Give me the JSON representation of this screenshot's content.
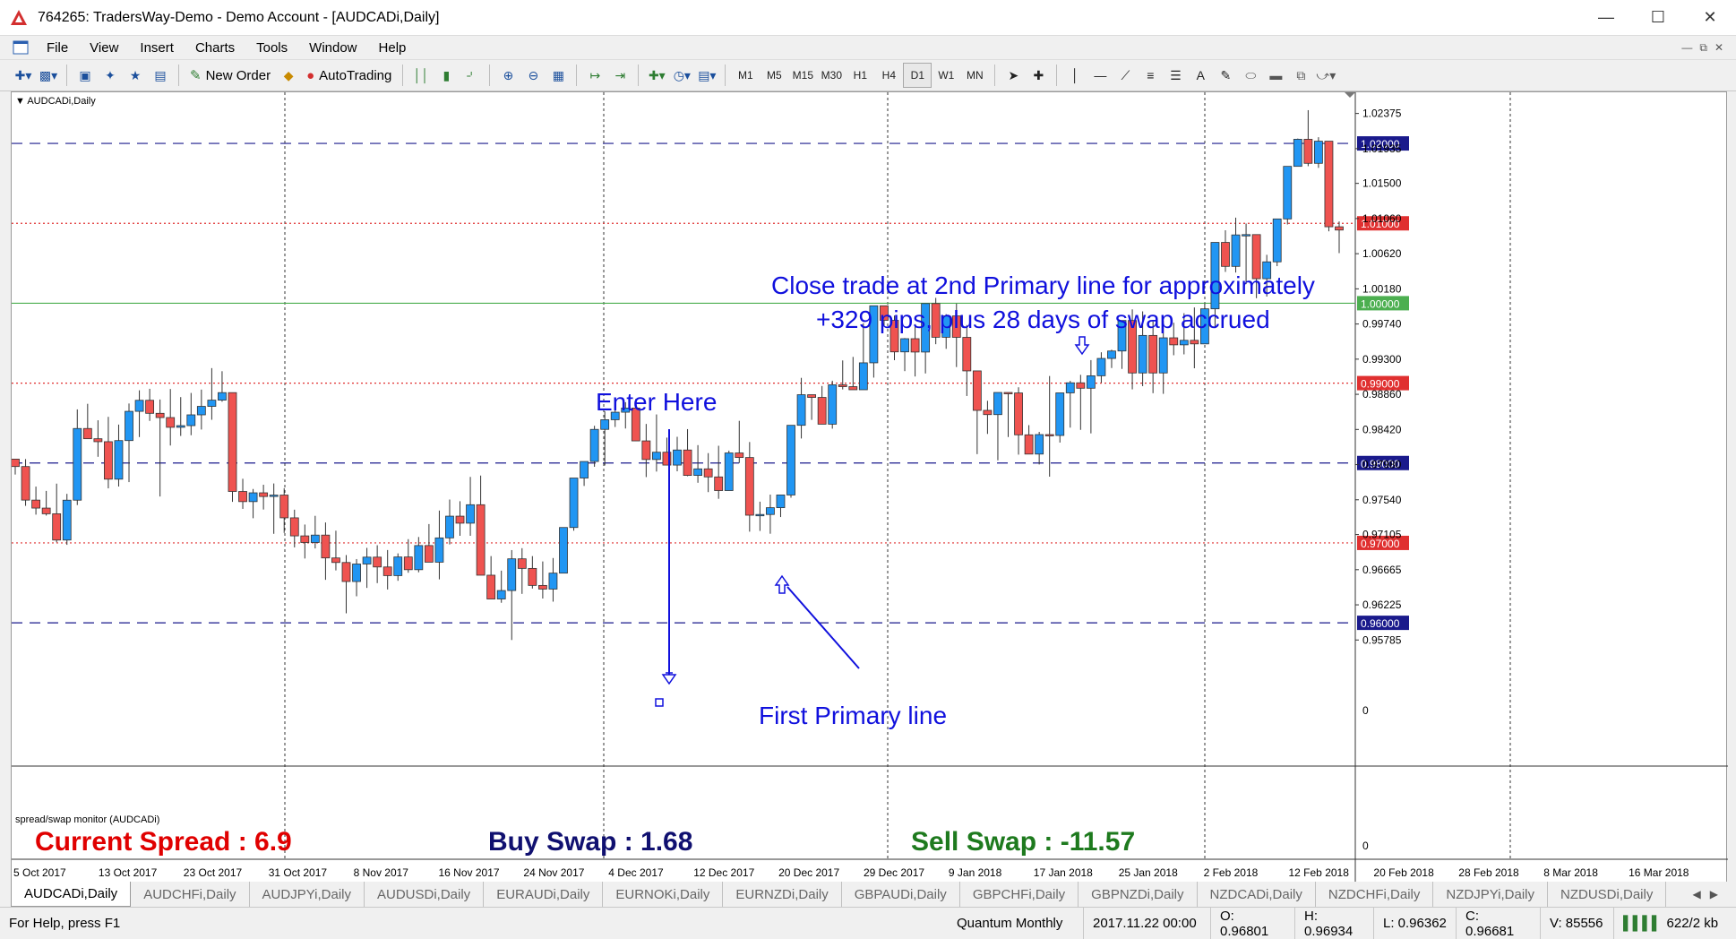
{
  "window": {
    "title": "764265: TradersWay-Demo - Demo Account - [AUDCADi,Daily]"
  },
  "menu": [
    "File",
    "View",
    "Insert",
    "Charts",
    "Tools",
    "Window",
    "Help"
  ],
  "toolbar": {
    "new_order": "New Order",
    "autotrading": "AutoTrading",
    "timeframes": [
      "M1",
      "M5",
      "M15",
      "M30",
      "H1",
      "H4",
      "D1",
      "W1",
      "MN"
    ],
    "active_timeframe": "D1"
  },
  "chart": {
    "symbol_label": "AUDCADi,Daily",
    "indicator_label": "spread/swap monitor (AUDCADi)"
  },
  "indicator": {
    "current_spread": "Current Spread : 6.9",
    "buy_swap": "Buy Swap : 1.68",
    "sell_swap": "Sell Swap : -11.57",
    "colors": {
      "current_spread": "#e00000",
      "buy_swap": "#101070",
      "sell_swap": "#1e7a1e"
    }
  },
  "annotations": {
    "enter_here": "Enter Here",
    "first_primary": "First Primary line",
    "close_trade_1": "Close trade at 2nd Primary line for approximately",
    "close_trade_2": "+329 pips, plus 28 days of swap accrued"
  },
  "chart_data": {
    "type": "candlestick",
    "symbol": "AUDCADi",
    "timeframe": "Daily",
    "ylim": [
      0.9562,
      1.0264
    ],
    "y_ticks": [
      "1.02375",
      "1.01935",
      "1.01500",
      "1.01060",
      "1.00620",
      "1.00180",
      "0.99740",
      "0.99300",
      "0.98860",
      "0.98420",
      "0.97980",
      "0.97540",
      "0.97105",
      "0.96665",
      "0.96225",
      "0.95785"
    ],
    "x_tick_labels": [
      "5 Oct 2017",
      "13 Oct 2017",
      "23 Oct 2017",
      "31 Oct 2017",
      "8 Nov 2017",
      "16 Nov 2017",
      "24 Nov 2017",
      "4 Dec 2017",
      "12 Dec 2017",
      "20 Dec 2017",
      "29 Dec 2017",
      "9 Jan 2018",
      "17 Jan 2018",
      "25 Jan 2018",
      "2 Feb 2018",
      "12 Feb 2018",
      "20 Feb 2018",
      "28 Feb 2018",
      "8 Mar 2018",
      "16 Mar 2018"
    ],
    "horizontal_lines": [
      {
        "label": "1.02000",
        "price": 1.02,
        "style": "dashed",
        "color": "#1a1a8c"
      },
      {
        "label": "1.01000",
        "price": 1.01,
        "style": "dotted",
        "color": "#e03030"
      },
      {
        "label": "1.00000",
        "price": 1.0,
        "style": "solid",
        "color": "#4caf50"
      },
      {
        "label": "0.99000",
        "price": 0.99,
        "style": "dotted",
        "color": "#e03030"
      },
      {
        "label": "0.98000",
        "price": 0.98,
        "style": "dashed",
        "color": "#1a1a8c"
      },
      {
        "label": "0.97000",
        "price": 0.97,
        "style": "dotted",
        "color": "#e03030"
      },
      {
        "label": "0.96000",
        "price": 0.96,
        "style": "dashed",
        "color": "#1a1a8c"
      }
    ],
    "indicator_scale": [
      "0",
      "0"
    ],
    "colors": {
      "bull": "#2196f3",
      "bear": "#ef5350",
      "outline": "#333333",
      "annotation": "#1010dd"
    },
    "candles": [
      [
        0.98049,
        0.98049,
        0.97856,
        0.97956
      ],
      [
        0.97956,
        0.98049,
        0.97464,
        0.97536
      ],
      [
        0.97536,
        0.97705,
        0.97354,
        0.97436
      ],
      [
        0.97436,
        0.97651,
        0.97342,
        0.97365
      ],
      [
        0.97365,
        0.97742,
        0.97007,
        0.97036
      ],
      [
        0.97036,
        0.97614,
        0.96976,
        0.97535
      ],
      [
        0.97535,
        0.98671,
        0.97474,
        0.98432
      ],
      [
        0.98432,
        0.98741,
        0.98337,
        0.98304
      ],
      [
        0.98304,
        0.98535,
        0.98078,
        0.98267
      ],
      [
        0.98267,
        0.98578,
        0.97683,
        0.97798
      ],
      [
        0.97798,
        0.98481,
        0.97706,
        0.98281
      ],
      [
        0.98281,
        0.98745,
        0.97761,
        0.98647
      ],
      [
        0.98647,
        0.9891,
        0.98325,
        0.98785
      ],
      [
        0.98785,
        0.98929,
        0.98527,
        0.98622
      ],
      [
        0.98622,
        0.98795,
        0.97581,
        0.98569
      ],
      [
        0.98569,
        0.98926,
        0.98219,
        0.98447
      ],
      [
        0.98447,
        0.98825,
        0.98339,
        0.98468
      ],
      [
        0.98468,
        0.98877,
        0.98348,
        0.98603
      ],
      [
        0.98603,
        0.98919,
        0.98419,
        0.98709
      ],
      [
        0.98709,
        0.99188,
        0.98541,
        0.98787
      ],
      [
        0.98787,
        0.99149,
        0.98767,
        0.98881
      ],
      [
        0.98881,
        0.98882,
        0.97514,
        0.97644
      ],
      [
        0.97644,
        0.97803,
        0.97426,
        0.97517
      ],
      [
        0.97517,
        0.97675,
        0.97309,
        0.97627
      ],
      [
        0.97627,
        0.97728,
        0.97418,
        0.97581
      ],
      [
        0.97581,
        0.97744,
        0.97114,
        0.97599
      ],
      [
        0.97599,
        0.97685,
        0.97125,
        0.97314
      ],
      [
        0.97314,
        0.97416,
        0.96944,
        0.97088
      ],
      [
        0.97088,
        0.9723,
        0.96805,
        0.97005
      ],
      [
        0.97005,
        0.97339,
        0.96931,
        0.97098
      ],
      [
        0.97098,
        0.97256,
        0.96538,
        0.96812
      ],
      [
        0.96812,
        0.97153,
        0.96656,
        0.96755
      ],
      [
        0.96755,
        0.96848,
        0.96119,
        0.96517
      ],
      [
        0.96517,
        0.96798,
        0.96332,
        0.96736
      ],
      [
        0.96736,
        0.96938,
        0.96437,
        0.96822
      ],
      [
        0.96822,
        0.96971,
        0.96497,
        0.96699
      ],
      [
        0.96699,
        0.96911,
        0.96417,
        0.96591
      ],
      [
        0.96591,
        0.96869,
        0.96526,
        0.96824
      ],
      [
        0.96824,
        0.97047,
        0.96627,
        0.96665
      ],
      [
        0.96665,
        0.97074,
        0.96632,
        0.96967
      ],
      [
        0.96967,
        0.97236,
        0.96784,
        0.96759
      ],
      [
        0.96759,
        0.97405,
        0.96544,
        0.97063
      ],
      [
        0.97063,
        0.97543,
        0.96981,
        0.97335
      ],
      [
        0.97335,
        0.97522,
        0.97089,
        0.97247
      ],
      [
        0.97247,
        0.97826,
        0.97089,
        0.97478
      ],
      [
        0.97478,
        0.97843,
        0.97378,
        0.96596
      ],
      [
        0.96596,
        0.96835,
        0.96373,
        0.96298
      ],
      [
        0.96298,
        0.96653,
        0.96251,
        0.96404
      ],
      [
        0.96404,
        0.9691,
        0.95785,
        0.96801
      ],
      [
        0.96801,
        0.96934,
        0.96362,
        0.96681
      ],
      [
        0.96681,
        0.96835,
        0.96429,
        0.96468
      ],
      [
        0.96468,
        0.96768,
        0.96304,
        0.96422
      ],
      [
        0.96422,
        0.96811,
        0.96265,
        0.96622
      ],
      [
        0.96622,
        0.97164,
        0.96618,
        0.97193
      ],
      [
        0.97193,
        0.97785,
        0.97153,
        0.97812
      ],
      [
        0.97812,
        0.97953,
        0.97713,
        0.98019
      ],
      [
        0.98019,
        0.98466,
        0.97953,
        0.98421
      ],
      [
        0.98421,
        0.98647,
        0.97969,
        0.98542
      ],
      [
        0.98542,
        0.98747,
        0.98451,
        0.98636
      ],
      [
        0.98636,
        0.98761,
        0.98432,
        0.98688
      ],
      [
        0.98688,
        0.98804,
        0.98327,
        0.98277
      ],
      [
        0.98277,
        0.98489,
        0.97824,
        0.98044
      ],
      [
        0.98044,
        0.98608,
        0.97893,
        0.98135
      ],
      [
        0.98135,
        0.98318,
        0.97993,
        0.97974
      ],
      [
        0.97974,
        0.98328,
        0.97896,
        0.98163
      ],
      [
        0.98163,
        0.98424,
        0.97835,
        0.97845
      ],
      [
        0.97845,
        0.98224,
        0.97753,
        0.97927
      ],
      [
        0.97927,
        0.98124,
        0.97636,
        0.97826
      ],
      [
        0.97826,
        0.98216,
        0.97552,
        0.97655
      ],
      [
        0.97655,
        0.98155,
        0.97713,
        0.98126
      ],
      [
        0.98126,
        0.98528,
        0.98,
        0.98069
      ],
      [
        0.98069,
        0.98263,
        0.97141,
        0.97347
      ],
      [
        0.97347,
        0.97516,
        0.9715,
        0.97356
      ],
      [
        0.97356,
        0.97605,
        0.97115,
        0.97441
      ],
      [
        0.97441,
        0.97573,
        0.97324,
        0.976
      ],
      [
        0.976,
        0.98403,
        0.97566,
        0.98472
      ],
      [
        0.98472,
        0.99066,
        0.98307,
        0.98855
      ],
      [
        0.98855,
        0.98846,
        0.9854,
        0.98821
      ],
      [
        0.98821,
        0.98964,
        0.98496,
        0.98486
      ],
      [
        0.98486,
        0.9903,
        0.9843,
        0.98979
      ],
      [
        0.98979,
        0.99284,
        0.98921,
        0.98956
      ],
      [
        0.98956,
        0.99328,
        0.98936,
        0.98917
      ],
      [
        0.98917,
        0.99749,
        0.98969,
        0.99254
      ],
      [
        0.99254,
        0.9995,
        0.99069,
        0.99968
      ],
      [
        0.99968,
        0.99882,
        0.99706,
        0.99786
      ],
      [
        0.99786,
        0.99846,
        0.99287,
        0.99391
      ],
      [
        0.99391,
        0.99564,
        0.9915,
        0.99556
      ],
      [
        0.99556,
        0.99738,
        0.99083,
        0.99389
      ],
      [
        0.99389,
        0.99708,
        0.99121,
        0.99996
      ],
      [
        0.99996,
        1.00067,
        0.99487,
        0.99574
      ],
      [
        0.99574,
        0.99863,
        0.99429,
        0.99841
      ],
      [
        0.99841,
        0.99995,
        0.99201,
        0.99573
      ],
      [
        0.99573,
        0.99727,
        0.98839,
        0.99153
      ],
      [
        0.99153,
        0.9914,
        0.98111,
        0.98659
      ],
      [
        0.98659,
        0.98779,
        0.98364,
        0.98606
      ],
      [
        0.98606,
        0.98755,
        0.98034,
        0.98883
      ],
      [
        0.98883,
        0.98781,
        0.98325,
        0.98877
      ],
      [
        0.98877,
        0.98948,
        0.98105,
        0.98353
      ],
      [
        0.98353,
        0.98474,
        0.98226,
        0.98112
      ],
      [
        0.98112,
        0.9839,
        0.97982,
        0.98356
      ],
      [
        0.98356,
        0.99089,
        0.97829,
        0.98345
      ],
      [
        0.98345,
        0.98862,
        0.98256,
        0.98878
      ],
      [
        0.98878,
        0.99028,
        0.98443,
        0.99004
      ],
      [
        0.99004,
        0.99104,
        0.98415,
        0.98936
      ],
      [
        0.98936,
        0.99288,
        0.98371,
        0.99092
      ],
      [
        0.99092,
        0.99386,
        0.99005,
        0.99309
      ],
      [
        0.99309,
        0.99418,
        0.99189,
        0.99402
      ],
      [
        0.99402,
        0.99707,
        0.99178,
        0.99784
      ],
      [
        0.99784,
        0.99923,
        0.98922,
        0.99127
      ],
      [
        0.99127,
        0.99898,
        0.98962,
        0.99597
      ],
      [
        0.99597,
        0.99773,
        0.98874,
        0.99127
      ],
      [
        0.99127,
        0.99783,
        0.98866,
        0.99567
      ],
      [
        0.99567,
        0.99756,
        0.99349,
        0.99479
      ],
      [
        0.99479,
        0.99875,
        0.9936,
        0.99536
      ],
      [
        0.99536,
        0.99947,
        0.99186,
        0.99491
      ],
      [
        0.99491,
        0.99999,
        0.99504,
        0.9993
      ],
      [
        0.9993,
        1.00359,
        0.99689,
        1.00761
      ],
      [
        1.00761,
        1.00913,
        1.00392,
        1.00461
      ],
      [
        1.00461,
        1.01071,
        1.00384,
        1.00855
      ],
      [
        1.00855,
        1.00997,
        1.00239,
        1.00859
      ],
      [
        1.00859,
        1.00765,
        1.00063,
        1.00307
      ],
      [
        1.00307,
        1.00606,
        1.00083,
        1.00518
      ],
      [
        1.00518,
        1.00924,
        1.00464,
        1.01055
      ],
      [
        1.01055,
        1.01683,
        1.00986,
        1.01713
      ],
      [
        1.01713,
        1.02061,
        1.01726,
        1.02052
      ],
      [
        1.02052,
        1.02416,
        1.01715,
        1.01751
      ],
      [
        1.01751,
        1.02078,
        1.01694,
        1.02028
      ],
      [
        1.02028,
        1.01795,
        1.009,
        1.00957
      ],
      [
        1.00957,
        1.01024,
        1.00627,
        1.00916
      ]
    ]
  },
  "tabs": [
    "AUDCADi,Daily",
    "AUDCHFi,Daily",
    "AUDJPYi,Daily",
    "AUDUSDi,Daily",
    "EURAUDi,Daily",
    "EURNOKi,Daily",
    "EURNZDi,Daily",
    "GBPAUDi,Daily",
    "GBPCHFi,Daily",
    "GBPNZDi,Daily",
    "NZDCADi,Daily",
    "NZDCHFi,Daily",
    "NZDJPYi,Daily",
    "NZDUSDi,Daily"
  ],
  "status": {
    "help": "For Help, press F1",
    "profile": "Quantum Monthly",
    "datetime": "2017.11.22 00:00",
    "open": "O: 0.96801",
    "high": "H: 0.96934",
    "low": "L: 0.96362",
    "close": "C: 0.96681",
    "volume": "V: 85556",
    "traffic": "622/2 kb"
  }
}
